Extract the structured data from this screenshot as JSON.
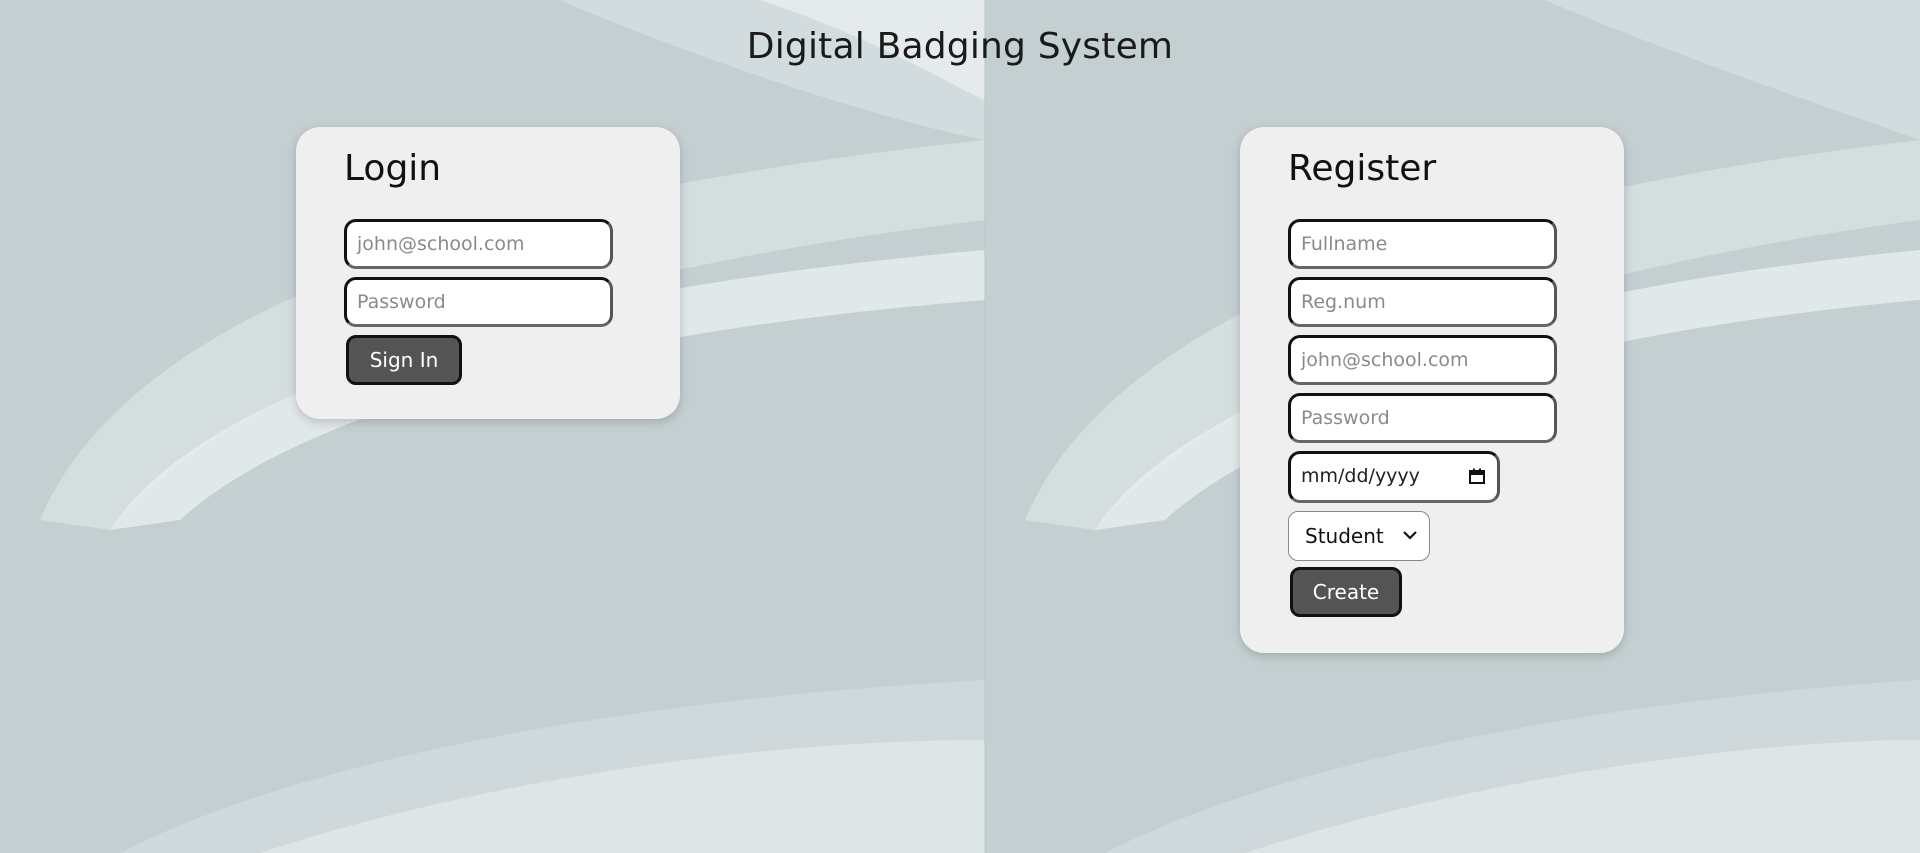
{
  "header": {
    "title": "Digital Badging System"
  },
  "login": {
    "title": "Login",
    "email_placeholder": "john@school.com",
    "password_placeholder": "Password",
    "submit_label": "Sign In"
  },
  "register": {
    "title": "Register",
    "fullname_placeholder": "Fullname",
    "regnum_placeholder": "Reg.num",
    "email_placeholder": "john@school.com",
    "password_placeholder": "Password",
    "date_placeholder": "mm/dd/yyyy",
    "role_selected": "Student",
    "submit_label": "Create"
  },
  "icons": {
    "date_icon": "calendar-icon",
    "select_icon": "chevron-down-icon"
  },
  "colors": {
    "background": "#c3cfd1",
    "card": "#efefef",
    "button": "#545454",
    "button_text": "#ffffff"
  }
}
